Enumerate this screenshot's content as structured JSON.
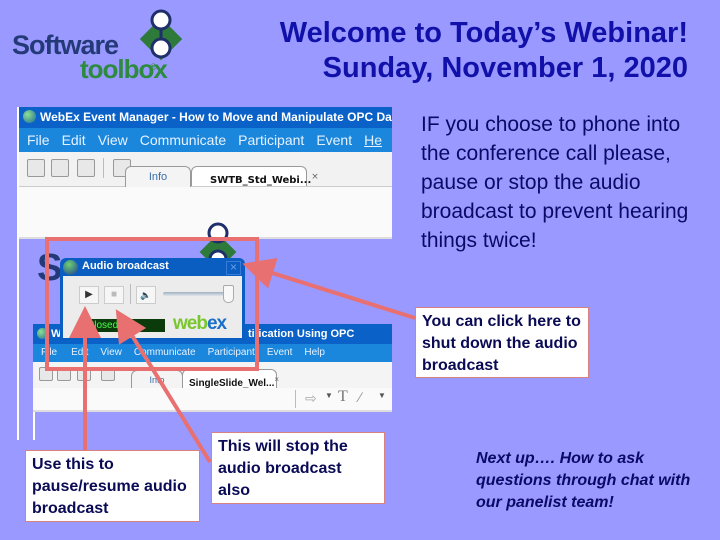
{
  "logo": {
    "line1": "Software",
    "line2": "toolbox",
    "registered": "®"
  },
  "header": {
    "title_line1": "Welcome to Today’s Webinar!",
    "title_line2": "Sunday, November 1, 2020"
  },
  "webex_window": {
    "title": "WebEx Event Manager -  How to Move and Manipulate OPC Data",
    "menu": [
      "File",
      "Edit",
      "View",
      "Communicate",
      "Participant",
      "Event",
      "He"
    ],
    "tabs": [
      {
        "label": "Info"
      },
      {
        "label": "SWTB_Std_Webi...",
        "close": "×"
      }
    ],
    "inner_window": {
      "title": "We",
      "title_tail": "tification Using OPC DataHub",
      "menu": [
        "File",
        "Edit",
        "View",
        "Communicate",
        "Participant",
        "Event",
        "Help"
      ],
      "tabs": [
        {
          "label": "Info"
        },
        {
          "label": "SingleSlide_Wel...",
          "close": "×"
        }
      ],
      "slide_logo_fragment": "So"
    },
    "audio_dialog": {
      "title": "Audio broadcast",
      "close": "×",
      "play_glyph": "▶",
      "stop_glyph": "■",
      "speaker_glyph": "🔈",
      "status": "Closed",
      "brand_web": "web",
      "brand_ex": "ex",
      "volume_level": 0.95
    }
  },
  "instructions": {
    "text": "IF you choose to phone into the conference call please, pause or stop the audio broadcast to prevent hearing things twice!"
  },
  "callouts": {
    "close": "You can click here to shut down the audio broadcast",
    "pause": "Use this to pause/resume audio broadcast",
    "stop": "This will stop the audio broadcast also"
  },
  "next_up": "Next up…. How to ask questions through chat with our panelist team!",
  "colors": {
    "background": "#9999ff",
    "title": "#1111aa",
    "annotation": "#e87070",
    "webex_blue": "#0a62c8"
  }
}
